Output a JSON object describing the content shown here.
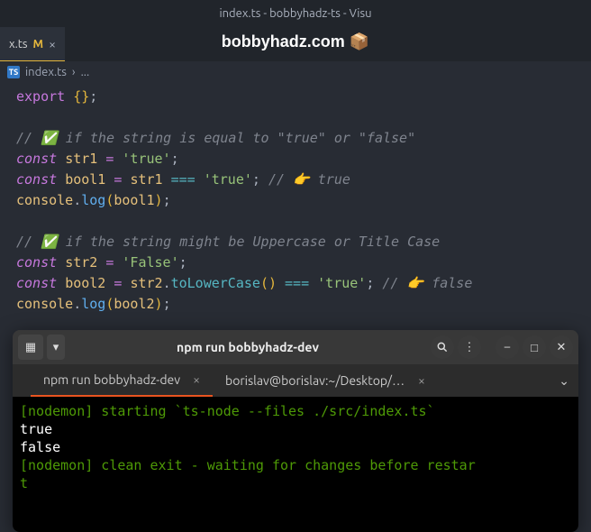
{
  "window": {
    "title": "index.ts - bobbyhadz-ts - Visu"
  },
  "watermark": {
    "text": "bobbyhadz.com 📦"
  },
  "tab": {
    "filename": "x.ts",
    "modified_marker": "M",
    "close": "×"
  },
  "breadcrumb": {
    "file": "index.ts",
    "sep": "›",
    "rest": "..."
  },
  "code": {
    "l1_export": "export",
    "l1_braces": " {}",
    "l1_semi": ";",
    "l3_comment": "// ✅ if the string is equal to \"true\" or \"false\"",
    "const_kw": "const",
    "str1": "str1",
    "eq": " = ",
    "true_lit": "'true'",
    "semi": ";",
    "bool1": "bool1",
    "tripleeq": " === ",
    "l5_comment": " // 👉️ true",
    "console": "console",
    "dot": ".",
    "log": "log",
    "l8_comment": "// ✅ if the string might be Uppercase or Title Case",
    "str2": "str2",
    "false_lit": "'False'",
    "bool2": "bool2",
    "toLower": "toLowerCase",
    "parens": "()",
    "l10_comment": " // 👉️ false"
  },
  "terminal": {
    "title": "npm run bobbyhadz-dev",
    "tab1": "npm run bobbyhadz-dev",
    "tab2": "borislav@borislav:~/Desktop/b…",
    "line1": "[nodemon] starting `ts-node --files ./src/index.ts`",
    "line2": "true",
    "line3": "false",
    "line4a": "[nodemon] clean exit - waiting for changes before restar",
    "line4b": "t"
  }
}
